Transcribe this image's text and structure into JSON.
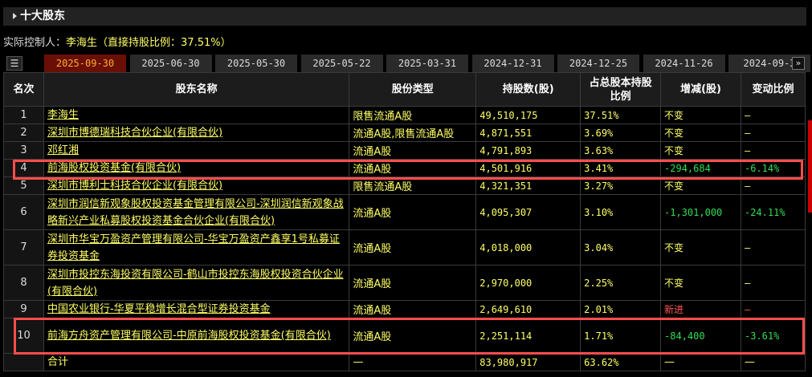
{
  "section_title": "十大股东",
  "controller": {
    "label": "实际控制人：",
    "name": "李海生",
    "detail": "（直接持股比例：37.51%）"
  },
  "tabs": [
    "2025-09-30",
    "2025-06-30",
    "2025-05-30",
    "2025-05-22",
    "2025-03-31",
    "2024-12-31",
    "2024-12-25",
    "2024-11-26",
    "2024-09-3"
  ],
  "headers": {
    "rank": "名次",
    "name": "股东名称",
    "type": "股份类型",
    "shares": "持股数(股)",
    "pct": "占总股本持股比例",
    "change": "增减(股)",
    "ratio": "变动比例"
  },
  "rows": [
    {
      "rank": "1",
      "name": "李海生",
      "type": "限售流通A股",
      "shares": "49,510,175",
      "pct": "37.51%",
      "change": "不变",
      "ratio": "—"
    },
    {
      "rank": "2",
      "name": "深圳市博德瑞科技合伙企业(有限合伙)",
      "type": "流通A股,限售流通A股",
      "shares": "4,871,551",
      "pct": "3.69%",
      "change": "不变",
      "ratio": "—"
    },
    {
      "rank": "3",
      "name": "邓红湘",
      "type": "流通A股",
      "shares": "4,791,893",
      "pct": "3.63%",
      "change": "不变",
      "ratio": "—"
    },
    {
      "rank": "4",
      "name": "前海股权投资基金(有限合伙)",
      "type": "流通A股",
      "shares": "4,501,916",
      "pct": "3.41%",
      "change": "-294,684",
      "ratio": "-6.14%"
    },
    {
      "rank": "5",
      "name": "深圳市博利士科技合伙企业(有限合伙)",
      "type": "限售流通A股",
      "shares": "4,321,351",
      "pct": "3.27%",
      "change": "不变",
      "ratio": "—"
    },
    {
      "rank": "6",
      "name": "深圳市润信新观象股权投资基金管理有限公司-深圳润信新观象战略新兴产业私募股权投资基金合伙企业(有限合伙)",
      "type": "流通A股",
      "shares": "4,095,307",
      "pct": "3.10%",
      "change": "-1,301,000",
      "ratio": "-24.11%"
    },
    {
      "rank": "7",
      "name": "深圳市华宝万盈资产管理有限公司-华宝万盈资产鑫享1号私募证券投资基金",
      "type": "流通A股",
      "shares": "4,018,000",
      "pct": "3.04%",
      "change": "不变",
      "ratio": "—"
    },
    {
      "rank": "8",
      "name": "深圳市投控东海投资有限公司-鹤山市投控东海股权投资合伙企业(有限合伙)",
      "type": "流通A股",
      "shares": "2,970,000",
      "pct": "2.25%",
      "change": "不变",
      "ratio": "—"
    },
    {
      "rank": "9",
      "name": "中国农业银行-华夏平稳增长混合型证券投资基金",
      "type": "流通A股",
      "shares": "2,649,610",
      "pct": "2.01%",
      "change": "新进",
      "ratio": "—"
    },
    {
      "rank": "10",
      "name": "前海方舟资产管理有限公司-中原前海股权投资基金(有限合伙)",
      "type": "流通A股",
      "shares": "2,251,114",
      "pct": "1.71%",
      "change": "-84,400",
      "ratio": "-3.61%"
    }
  ],
  "total": {
    "name": "合计",
    "type": "—",
    "shares": "83,980,917",
    "pct": "63.62%",
    "change": "—",
    "ratio": "—"
  },
  "colors": {
    "text": "#ffff66",
    "down": "#33dd55",
    "new": "#ff5555",
    "highlight": "#ff4d4d"
  }
}
